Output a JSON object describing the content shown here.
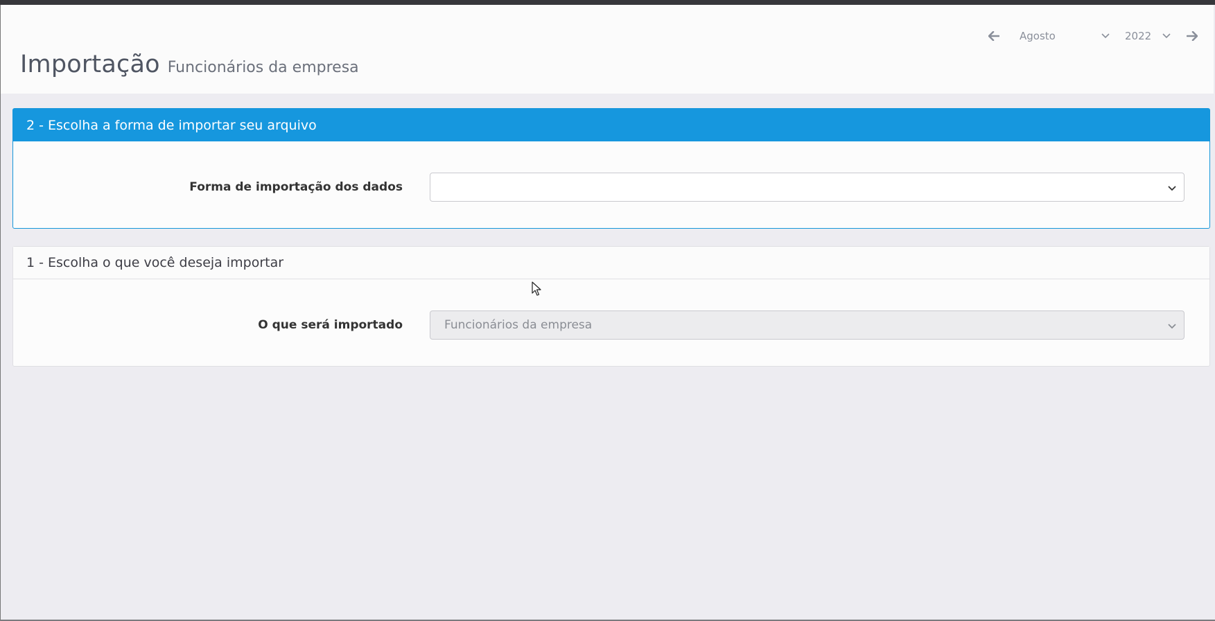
{
  "header": {
    "title": "Importação",
    "subtitle": "Funcionários da empresa",
    "period": {
      "prev_icon": "arrow-left-icon",
      "month": "Agosto",
      "year": "2022",
      "next_icon": "arrow-right-icon"
    }
  },
  "step2": {
    "heading": "2 - Escolha a forma de importar seu arquivo",
    "field_label": "Forma de importação dos dados",
    "field_value": ""
  },
  "step1": {
    "heading": "1 - Escolha o que você deseja importar",
    "field_label": "O que será importado",
    "field_value": "Funcionários da empresa"
  },
  "colors": {
    "primary": "#1697de",
    "background": "#edecf1",
    "header_background": "#fbfbfb"
  }
}
